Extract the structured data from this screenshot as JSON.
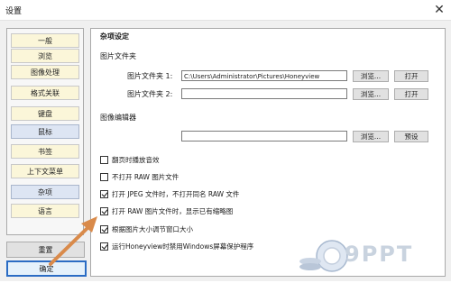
{
  "window": {
    "title": "设置",
    "close_symbol": "✕"
  },
  "sidebar": {
    "items": [
      {
        "label": "一般",
        "active": false
      },
      {
        "label": "浏览",
        "active": false
      },
      {
        "label": "图像处理",
        "active": false
      },
      {
        "label": "格式关联",
        "active": false
      },
      {
        "label": "键盘",
        "active": false
      },
      {
        "label": "鼠标",
        "active": true
      },
      {
        "label": "书签",
        "active": false
      },
      {
        "label": "上下文菜单",
        "active": false
      },
      {
        "label": "杂项",
        "active": true
      },
      {
        "label": "语言",
        "active": false
      }
    ]
  },
  "footer": {
    "reset_label": "重置",
    "ok_label": "确定"
  },
  "main": {
    "section_title": "杂项设定",
    "image_folder": {
      "heading": "图片文件夹",
      "folder1_label": "图片文件夹 1:",
      "folder1_value": "C:\\Users\\Administrator\\Pictures\\Honeyview",
      "folder2_label": "图片文件夹 2:",
      "folder2_value": "",
      "browse_label": "浏览...",
      "open_label": "打开"
    },
    "image_editor": {
      "heading": "图像编辑器",
      "value": "",
      "browse_label": "浏览...",
      "default_label": "预设"
    },
    "options": [
      {
        "label": "翻页时播放音效",
        "checked": false
      },
      {
        "label": "不打开 RAW 图片文件",
        "checked": false
      },
      {
        "label": "打开 JPEG 文件时，不打开同名 RAW 文件",
        "checked": true
      },
      {
        "label": "打开 RAW 图片文件时，显示已有缩略图",
        "checked": true
      },
      {
        "label": "根据图片大小调节窗口大小",
        "checked": true
      },
      {
        "label": "运行Honeyview时禁用Windows屏幕保护程序",
        "checked": true
      }
    ]
  },
  "watermark": {
    "text": "9PPT"
  },
  "colors": {
    "nav_default": "#fbf6d9",
    "nav_active": "#dde5f3",
    "primary_border": "#2b6cc4",
    "arrow": "#d98a4a"
  }
}
